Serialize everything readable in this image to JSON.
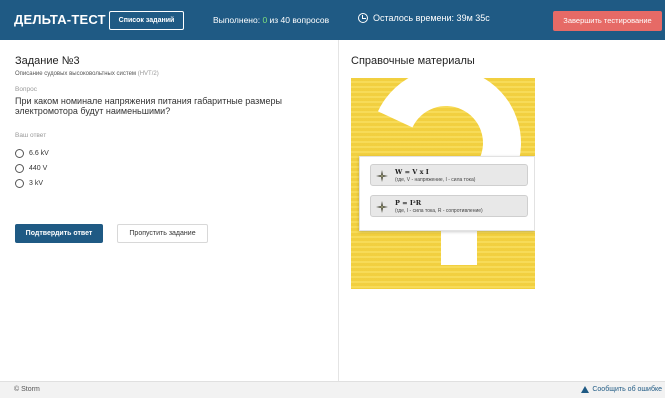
{
  "header": {
    "brand": "ДЕЛЬТА-ТЕСТ",
    "tasks_button": "Список заданий",
    "progress_prefix": "Выполнено: ",
    "progress_done": "0",
    "progress_suffix": " из 40 вопросов",
    "timer": "Осталось времени: 39м 35с",
    "finish_button": "Завершить тестирование"
  },
  "task": {
    "title": "Задание №3",
    "description": "Описание судовых высоковольтных систем",
    "code": "(HVT/2)",
    "question_label": "Вопрос",
    "question_text": "При каком номинале напряжения питания габаритные размеры электромотора будут наименьшими?",
    "answer_label": "Ваш ответ",
    "options": [
      {
        "label": "6.6 kV"
      },
      {
        "label": "440 V"
      },
      {
        "label": "3 kV"
      }
    ],
    "submit_button": "Подтвердить ответ",
    "skip_button": "Пропустить задание"
  },
  "reference": {
    "title": "Справочные материалы",
    "formulas": [
      {
        "main": "W = V x I",
        "note": "(где, V - напряжение, I - сила тока)"
      },
      {
        "main": "P = I²R",
        "note": "(где, I - сила тока, R - сопротивление)"
      }
    ]
  },
  "footer": {
    "copyright": "© Storm",
    "report": "Сообщить об ошибке"
  },
  "colors": {
    "header_bg": "#1f5a84",
    "finish_button": "#e66a66",
    "progress_done": "#7ee07e",
    "reference_bg": "#f5d344"
  },
  "icons": {
    "timer": "clock-icon",
    "formula": "compass-star-icon",
    "report": "warning-triangle-icon"
  }
}
